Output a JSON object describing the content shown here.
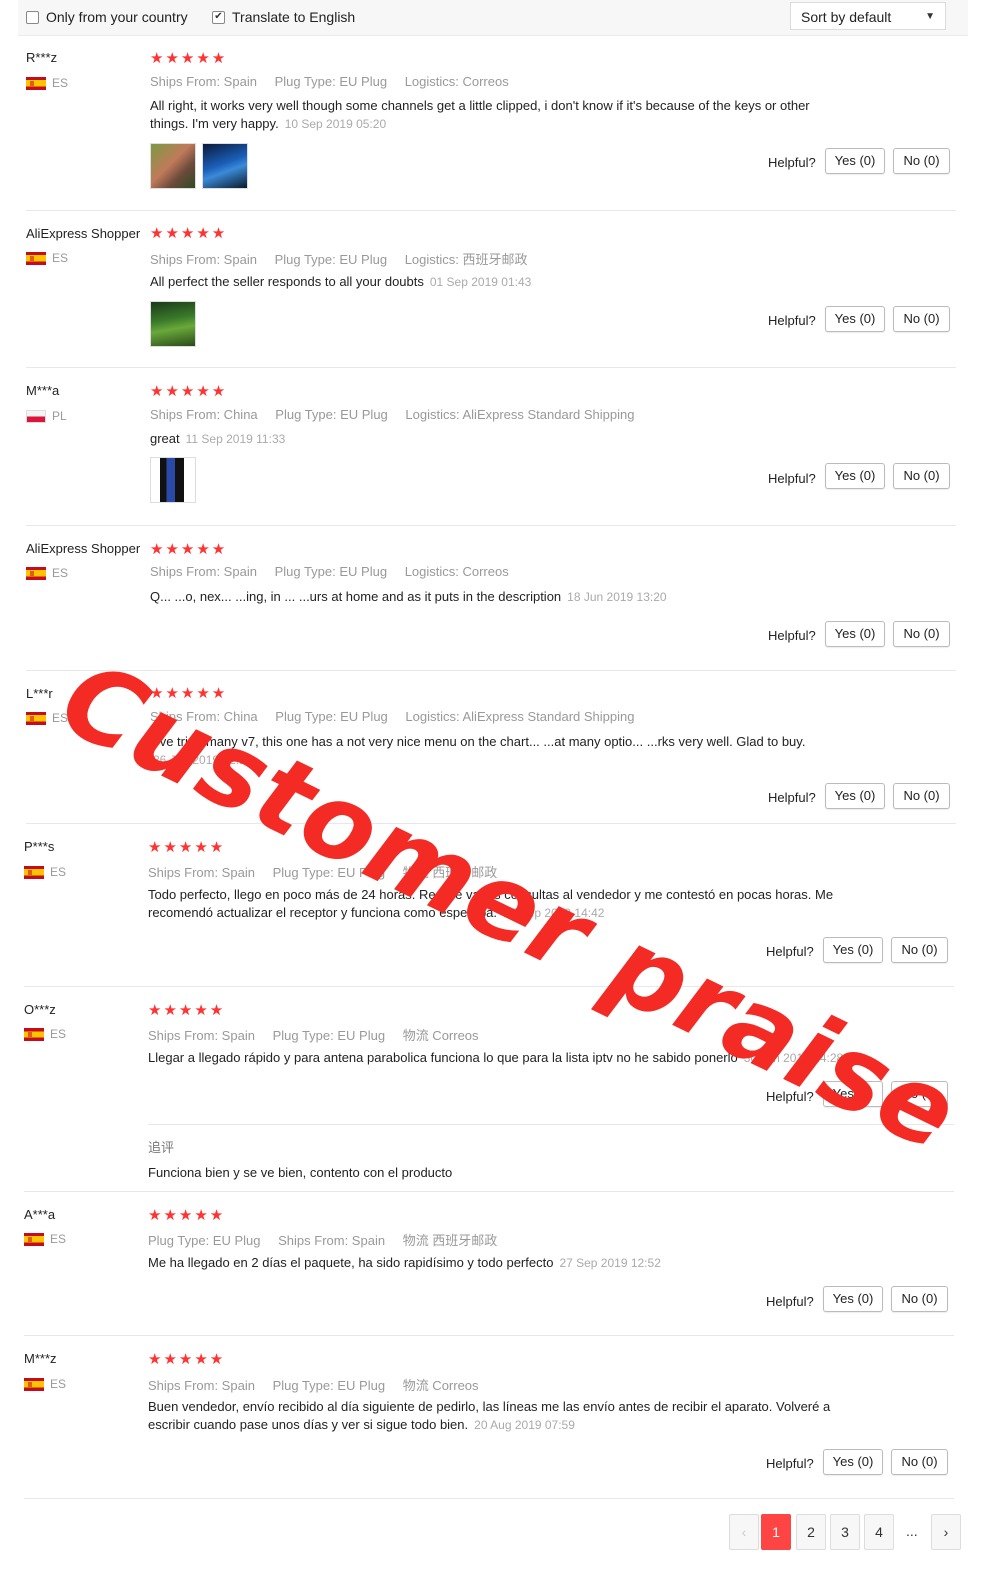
{
  "filters": {
    "only_country": "Only from your country",
    "translate": "Translate to English",
    "translate_checked": "✔",
    "sort": "Sort by default"
  },
  "labels": {
    "helpful": "Helpful?",
    "followup": "追评"
  },
  "reviews": [
    {
      "user": "R***z",
      "country": "ES",
      "stars": "★★★★★",
      "meta": [
        "Ships From: Spain",
        "Plug Type: EU Plug",
        "Logistics: Correos"
      ],
      "text": "All right, it works very well though some channels get a little clipped, i don't know if it's because of the keys or other things. I'm very happy.",
      "date": "10 Sep 2019 05:20",
      "yes": "Yes (0)",
      "no": "No (0)"
    },
    {
      "user": "AliExpress Shopper",
      "country": "ES",
      "stars": "★★★★★",
      "meta": [
        "Ships From: Spain",
        "Plug Type: EU Plug",
        "Logistics: 西班牙邮政"
      ],
      "text": "All perfect the seller responds to all your doubts",
      "date": "01 Sep 2019 01:43",
      "yes": "Yes (0)",
      "no": "No (0)"
    },
    {
      "user": "M***a",
      "country": "PL",
      "stars": "★★★★★",
      "meta": [
        "Ships From: China",
        "Plug Type: EU Plug",
        "Logistics: AliExpress Standard Shipping"
      ],
      "text": "great",
      "date": "11 Sep 2019 11:33",
      "yes": "Yes (0)",
      "no": "No (0)"
    },
    {
      "user": "AliExpress Shopper",
      "country": "ES",
      "stars": "★★★★★",
      "meta": [
        "Ships From: Spain",
        "Plug Type: EU Plug",
        "Logistics: Correos"
      ],
      "text": "Q... ...o, nex... ...ing, in ... ...urs at home and as it puts in the description",
      "date": "18 Jun 2019 13:20",
      "yes": "Yes (0)",
      "no": "No (0)"
    },
    {
      "user": "L***r",
      "country": "ES",
      "stars": "★★★★★",
      "meta": [
        "Ships From: China",
        "Plug Type: EU Plug",
        "Logistics: AliExpress Standard Shipping"
      ],
      "text": "I 've tried many v7, this one has a not very nice menu on the chart... ...at many optio... ...rks very well. Glad to buy.",
      "date": "26 Jun 2019 02:19",
      "yes": "Yes (0)",
      "no": "No (0)"
    },
    {
      "user": "P***s",
      "country": "ES",
      "stars": "★★★★★",
      "meta": [
        "Ships From: Spain",
        "Plug Type: EU Plug",
        "物流 西班牙邮政"
      ],
      "text": "Todo perfecto, llego en poco más de 24 horas. Realice varias consultas al vendedor y me contestó en pocas horas. Me recomendó actualizar el receptor y funciona como esperaba.",
      "date": "17 Sep 2019 14:42",
      "yes": "Yes (0)",
      "no": "No (0)"
    },
    {
      "user": "O***z",
      "country": "ES",
      "stars": "★★★★★",
      "meta": [
        "Ships From: Spain",
        "Plug Type: EU Plug",
        "物流 Correos"
      ],
      "text": "Llegar a llegado rápido y para antena parabolica funciona lo que para la lista iptv no he sabido ponerlo",
      "date": "30 Jun 2019 14:28",
      "yes": "Yes (0)",
      "no": "No (0)",
      "followup": "Funciona bien y se ve bien, contento con el producto"
    },
    {
      "user": "A***a",
      "country": "ES",
      "stars": "★★★★★",
      "meta": [
        "Plug Type: EU Plug",
        "Ships From: Spain",
        "物流 西班牙邮政"
      ],
      "text": "Me ha llegado en 2 días el paquete, ha sido rapidísimo y todo perfecto",
      "date": "27 Sep 2019 12:52",
      "yes": "Yes (0)",
      "no": "No (0)"
    },
    {
      "user": "M***z",
      "country": "ES",
      "stars": "★★★★★",
      "meta": [
        "Ships From: Spain",
        "Plug Type: EU Plug",
        "物流 Correos"
      ],
      "text": "Buen vendedor, envío recibido al día siguiente de pedirlo, las líneas me las envío antes de recibir el aparato. Volveré a escribir cuando pase unos días y ver si sigue todo bien.",
      "date": "20 Aug 2019 07:59",
      "yes": "Yes (0)",
      "no": "No (0)"
    }
  ],
  "pagination": {
    "prev": "‹",
    "pages": [
      "1",
      "2",
      "3",
      "4"
    ],
    "ellipsis": "...",
    "next": "›",
    "current": "1"
  },
  "watermark": "Customer praise",
  "colors": {
    "star": "#ff3333",
    "watermark": "#f42a24",
    "active_page": "#ff4444"
  }
}
